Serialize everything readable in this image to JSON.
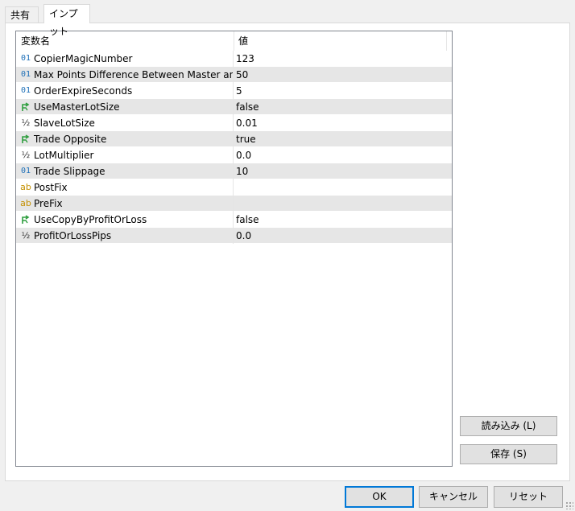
{
  "tabs": [
    {
      "label": "共有",
      "active": false
    },
    {
      "label": "インプット",
      "active": true
    }
  ],
  "grid": {
    "columns": {
      "name": "変数名",
      "value": "値"
    },
    "rows": [
      {
        "type": "int",
        "icon": "int-type-icon",
        "name": "CopierMagicNumber",
        "value": "123"
      },
      {
        "type": "int",
        "icon": "int-type-icon",
        "name": "Max Points Difference Between Master and S...",
        "value": "50"
      },
      {
        "type": "int",
        "icon": "int-type-icon",
        "name": "OrderExpireSeconds",
        "value": "5"
      },
      {
        "type": "bool",
        "icon": "bool-type-icon",
        "name": "UseMasterLotSize",
        "value": "false"
      },
      {
        "type": "double",
        "icon": "double-type-icon",
        "name": "SlaveLotSize",
        "value": "0.01"
      },
      {
        "type": "bool",
        "icon": "bool-type-icon",
        "name": "Trade Opposite",
        "value": "true"
      },
      {
        "type": "double",
        "icon": "double-type-icon",
        "name": "LotMultiplier",
        "value": "0.0"
      },
      {
        "type": "int",
        "icon": "int-type-icon",
        "name": "Trade Slippage",
        "value": "10"
      },
      {
        "type": "string",
        "icon": "string-type-icon",
        "name": "PostFix",
        "value": ""
      },
      {
        "type": "string",
        "icon": "string-type-icon",
        "name": "PreFix",
        "value": ""
      },
      {
        "type": "bool",
        "icon": "bool-type-icon",
        "name": "UseCopyByProfitOrLoss",
        "value": "false"
      },
      {
        "type": "double",
        "icon": "double-type-icon",
        "name": "ProfitOrLossPips",
        "value": "0.0"
      }
    ],
    "type_glyphs": {
      "int": "01",
      "double": "½",
      "string": "ab"
    },
    "bool_icon_color": "#2e9e3e",
    "alt_row_color": "#e6e6e6"
  },
  "side_buttons": {
    "load": "読み込み (L)",
    "save": "保存 (S)"
  },
  "bottom_buttons": {
    "ok": "OK",
    "cancel": "キャンセル",
    "reset": "リセット"
  },
  "accent_color": "#0078d7"
}
